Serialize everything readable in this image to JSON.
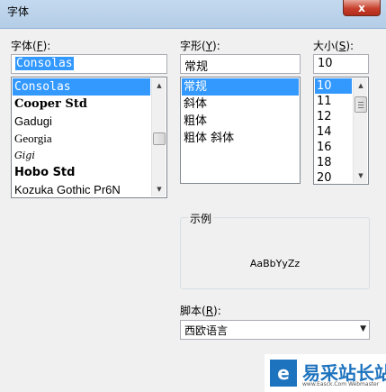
{
  "window": {
    "title": "字体",
    "close_label": "x"
  },
  "font": {
    "label": "字体(",
    "hotkey": "F",
    "label_end": "):",
    "value": "Consolas",
    "items": [
      "Consolas",
      "Cooper Std",
      "Gadugi",
      "Georgia",
      "Gigi",
      "Hobo Std",
      "Kozuka Gothic Pr6N"
    ],
    "selected_index": 0
  },
  "style": {
    "label": "字形(",
    "hotkey": "Y",
    "label_end": "):",
    "value": "常规",
    "items": [
      "常规",
      "斜体",
      "粗体",
      "粗体 斜体"
    ],
    "selected_index": 0
  },
  "size": {
    "label": "大小(",
    "hotkey": "S",
    "label_end": "):",
    "value": "10",
    "items": [
      "10",
      "11",
      "12",
      "14",
      "16",
      "18",
      "20"
    ],
    "selected_index": 0
  },
  "sample": {
    "title": "示例",
    "text": "AaBbYyZz"
  },
  "script": {
    "label": "脚本(",
    "hotkey": "R",
    "label_end": "):",
    "value": "西欧语言"
  },
  "watermark": {
    "logo": "e",
    "text": "易采站长站",
    "sub": "www.Easck.Com Webmaster"
  }
}
